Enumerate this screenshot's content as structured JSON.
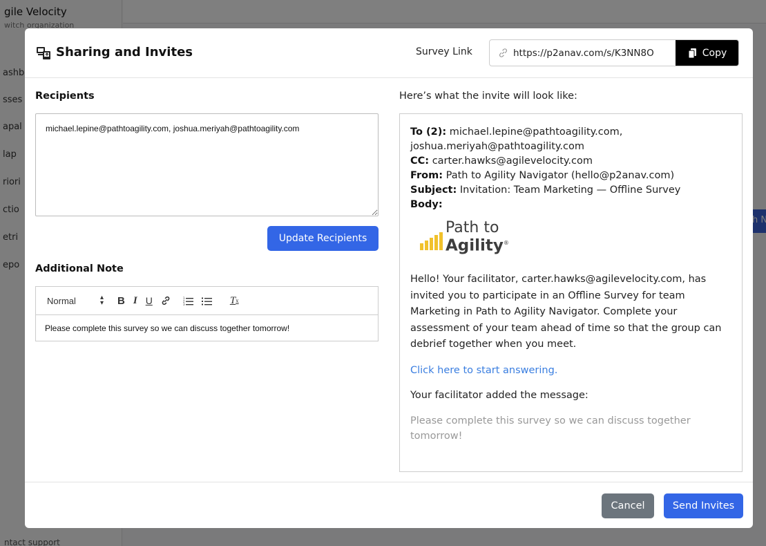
{
  "background": {
    "org_name": "gile Velocity",
    "org_switch": "witch organization",
    "sidebar_fragments": [
      "ashb",
      "sses",
      "apal",
      "lap",
      "riori",
      "ctio",
      "etri",
      "epo"
    ],
    "footer_fragment": "ntact support",
    "right_button_fragment": "h N"
  },
  "modal": {
    "title": "Sharing and Invites",
    "header_icon": "share-devices-icon",
    "survey_link": {
      "label": "Survey Link",
      "url": "https://p2anav.com/s/K3NN8O",
      "link_icon": "link-icon",
      "copy_label": "Copy",
      "copy_icon": "copy-icon"
    },
    "recipients": {
      "heading": "Recipients",
      "value": "michael.lepine@pathtoagility.com, joshua.meriyah@pathtoagility.com",
      "update_button": "Update Recipients"
    },
    "note": {
      "heading": "Additional Note",
      "format_select": "Normal",
      "toolbar": [
        "bold",
        "italic",
        "underline",
        "link",
        "ordered-list",
        "bullet-list",
        "clear-format"
      ],
      "content": "Please complete this survey so we can discuss together tomorrow!"
    },
    "preview": {
      "heading": "Here’s what the invite will look like:",
      "to_label": "To (2):",
      "to_value": "michael.lepine@pathtoagility.com,",
      "to_value_2": "joshua.meriyah@pathtoagility.com",
      "cc_label": "CC:",
      "cc_value": "carter.hawks@agilevelocity.com",
      "from_label": "From:",
      "from_value": "Path to Agility Navigator (hello@p2anav.com)",
      "subject_label": "Subject:",
      "subject_value": "Invitation: Team Marketing — Offline Survey",
      "body_label": "Body:",
      "logo_line1": "Path to",
      "logo_line2": "Agility",
      "logo_reg": "®",
      "body_text": "Hello! Your facilitator, carter.hawks@agilevelocity.com, has invited you to participate in an Offline Survey for team Marketing in Path to Agility Navigator. Complete your assessment of your team ahead of time so that the group can debrief together when you meet.",
      "link_text": "Click here to start answering.",
      "message_label": "Your facilitator added the message:",
      "message": "Please complete this survey so we can discuss together tomorrow!"
    },
    "footer": {
      "cancel": "Cancel",
      "send": "Send Invites"
    }
  },
  "colors": {
    "primary": "#3366e6",
    "secondary": "#6c757d",
    "copy_button": "#000000",
    "logo_bars": "#f1c12b",
    "link": "#3a7ee0"
  }
}
